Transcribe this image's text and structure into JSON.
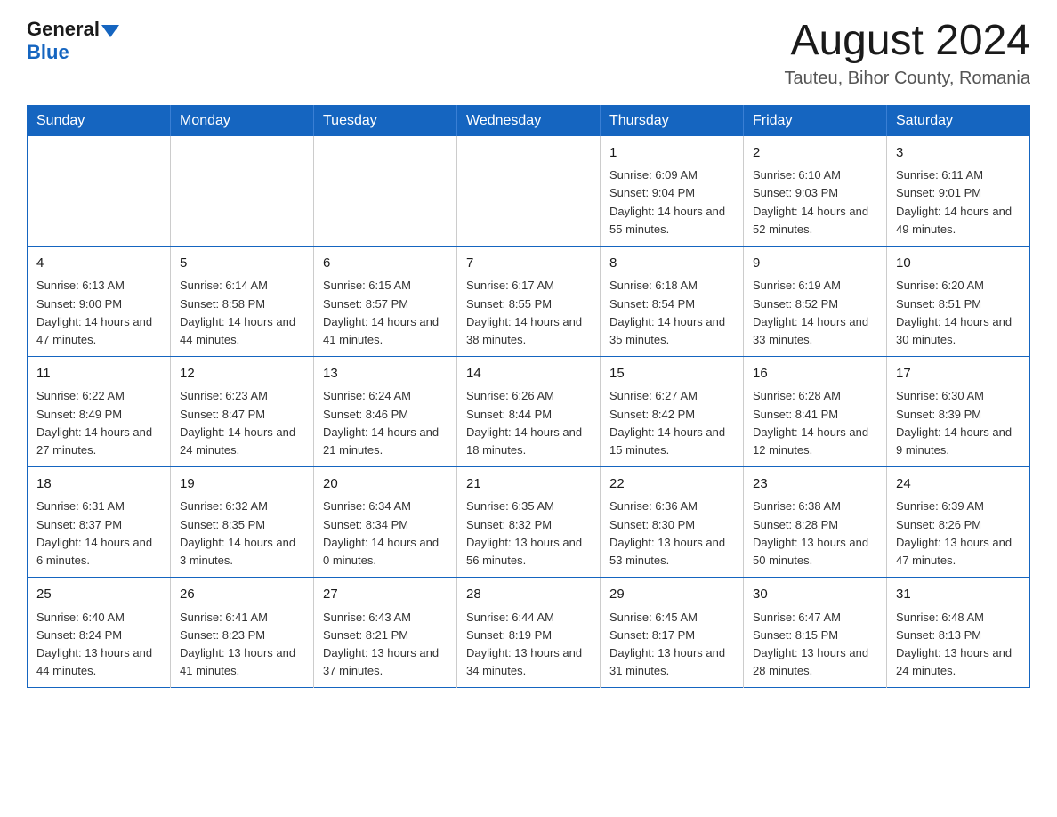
{
  "logo": {
    "general": "General",
    "blue": "Blue",
    "triangle": "▲"
  },
  "title": "August 2024",
  "location": "Tauteu, Bihor County, Romania",
  "days_of_week": [
    "Sunday",
    "Monday",
    "Tuesday",
    "Wednesday",
    "Thursday",
    "Friday",
    "Saturday"
  ],
  "weeks": [
    [
      {
        "day": "",
        "info": ""
      },
      {
        "day": "",
        "info": ""
      },
      {
        "day": "",
        "info": ""
      },
      {
        "day": "",
        "info": ""
      },
      {
        "day": "1",
        "info": "Sunrise: 6:09 AM\nSunset: 9:04 PM\nDaylight: 14 hours and 55 minutes."
      },
      {
        "day": "2",
        "info": "Sunrise: 6:10 AM\nSunset: 9:03 PM\nDaylight: 14 hours and 52 minutes."
      },
      {
        "day": "3",
        "info": "Sunrise: 6:11 AM\nSunset: 9:01 PM\nDaylight: 14 hours and 49 minutes."
      }
    ],
    [
      {
        "day": "4",
        "info": "Sunrise: 6:13 AM\nSunset: 9:00 PM\nDaylight: 14 hours and 47 minutes."
      },
      {
        "day": "5",
        "info": "Sunrise: 6:14 AM\nSunset: 8:58 PM\nDaylight: 14 hours and 44 minutes."
      },
      {
        "day": "6",
        "info": "Sunrise: 6:15 AM\nSunset: 8:57 PM\nDaylight: 14 hours and 41 minutes."
      },
      {
        "day": "7",
        "info": "Sunrise: 6:17 AM\nSunset: 8:55 PM\nDaylight: 14 hours and 38 minutes."
      },
      {
        "day": "8",
        "info": "Sunrise: 6:18 AM\nSunset: 8:54 PM\nDaylight: 14 hours and 35 minutes."
      },
      {
        "day": "9",
        "info": "Sunrise: 6:19 AM\nSunset: 8:52 PM\nDaylight: 14 hours and 33 minutes."
      },
      {
        "day": "10",
        "info": "Sunrise: 6:20 AM\nSunset: 8:51 PM\nDaylight: 14 hours and 30 minutes."
      }
    ],
    [
      {
        "day": "11",
        "info": "Sunrise: 6:22 AM\nSunset: 8:49 PM\nDaylight: 14 hours and 27 minutes."
      },
      {
        "day": "12",
        "info": "Sunrise: 6:23 AM\nSunset: 8:47 PM\nDaylight: 14 hours and 24 minutes."
      },
      {
        "day": "13",
        "info": "Sunrise: 6:24 AM\nSunset: 8:46 PM\nDaylight: 14 hours and 21 minutes."
      },
      {
        "day": "14",
        "info": "Sunrise: 6:26 AM\nSunset: 8:44 PM\nDaylight: 14 hours and 18 minutes."
      },
      {
        "day": "15",
        "info": "Sunrise: 6:27 AM\nSunset: 8:42 PM\nDaylight: 14 hours and 15 minutes."
      },
      {
        "day": "16",
        "info": "Sunrise: 6:28 AM\nSunset: 8:41 PM\nDaylight: 14 hours and 12 minutes."
      },
      {
        "day": "17",
        "info": "Sunrise: 6:30 AM\nSunset: 8:39 PM\nDaylight: 14 hours and 9 minutes."
      }
    ],
    [
      {
        "day": "18",
        "info": "Sunrise: 6:31 AM\nSunset: 8:37 PM\nDaylight: 14 hours and 6 minutes."
      },
      {
        "day": "19",
        "info": "Sunrise: 6:32 AM\nSunset: 8:35 PM\nDaylight: 14 hours and 3 minutes."
      },
      {
        "day": "20",
        "info": "Sunrise: 6:34 AM\nSunset: 8:34 PM\nDaylight: 14 hours and 0 minutes."
      },
      {
        "day": "21",
        "info": "Sunrise: 6:35 AM\nSunset: 8:32 PM\nDaylight: 13 hours and 56 minutes."
      },
      {
        "day": "22",
        "info": "Sunrise: 6:36 AM\nSunset: 8:30 PM\nDaylight: 13 hours and 53 minutes."
      },
      {
        "day": "23",
        "info": "Sunrise: 6:38 AM\nSunset: 8:28 PM\nDaylight: 13 hours and 50 minutes."
      },
      {
        "day": "24",
        "info": "Sunrise: 6:39 AM\nSunset: 8:26 PM\nDaylight: 13 hours and 47 minutes."
      }
    ],
    [
      {
        "day": "25",
        "info": "Sunrise: 6:40 AM\nSunset: 8:24 PM\nDaylight: 13 hours and 44 minutes."
      },
      {
        "day": "26",
        "info": "Sunrise: 6:41 AM\nSunset: 8:23 PM\nDaylight: 13 hours and 41 minutes."
      },
      {
        "day": "27",
        "info": "Sunrise: 6:43 AM\nSunset: 8:21 PM\nDaylight: 13 hours and 37 minutes."
      },
      {
        "day": "28",
        "info": "Sunrise: 6:44 AM\nSunset: 8:19 PM\nDaylight: 13 hours and 34 minutes."
      },
      {
        "day": "29",
        "info": "Sunrise: 6:45 AM\nSunset: 8:17 PM\nDaylight: 13 hours and 31 minutes."
      },
      {
        "day": "30",
        "info": "Sunrise: 6:47 AM\nSunset: 8:15 PM\nDaylight: 13 hours and 28 minutes."
      },
      {
        "day": "31",
        "info": "Sunrise: 6:48 AM\nSunset: 8:13 PM\nDaylight: 13 hours and 24 minutes."
      }
    ]
  ]
}
